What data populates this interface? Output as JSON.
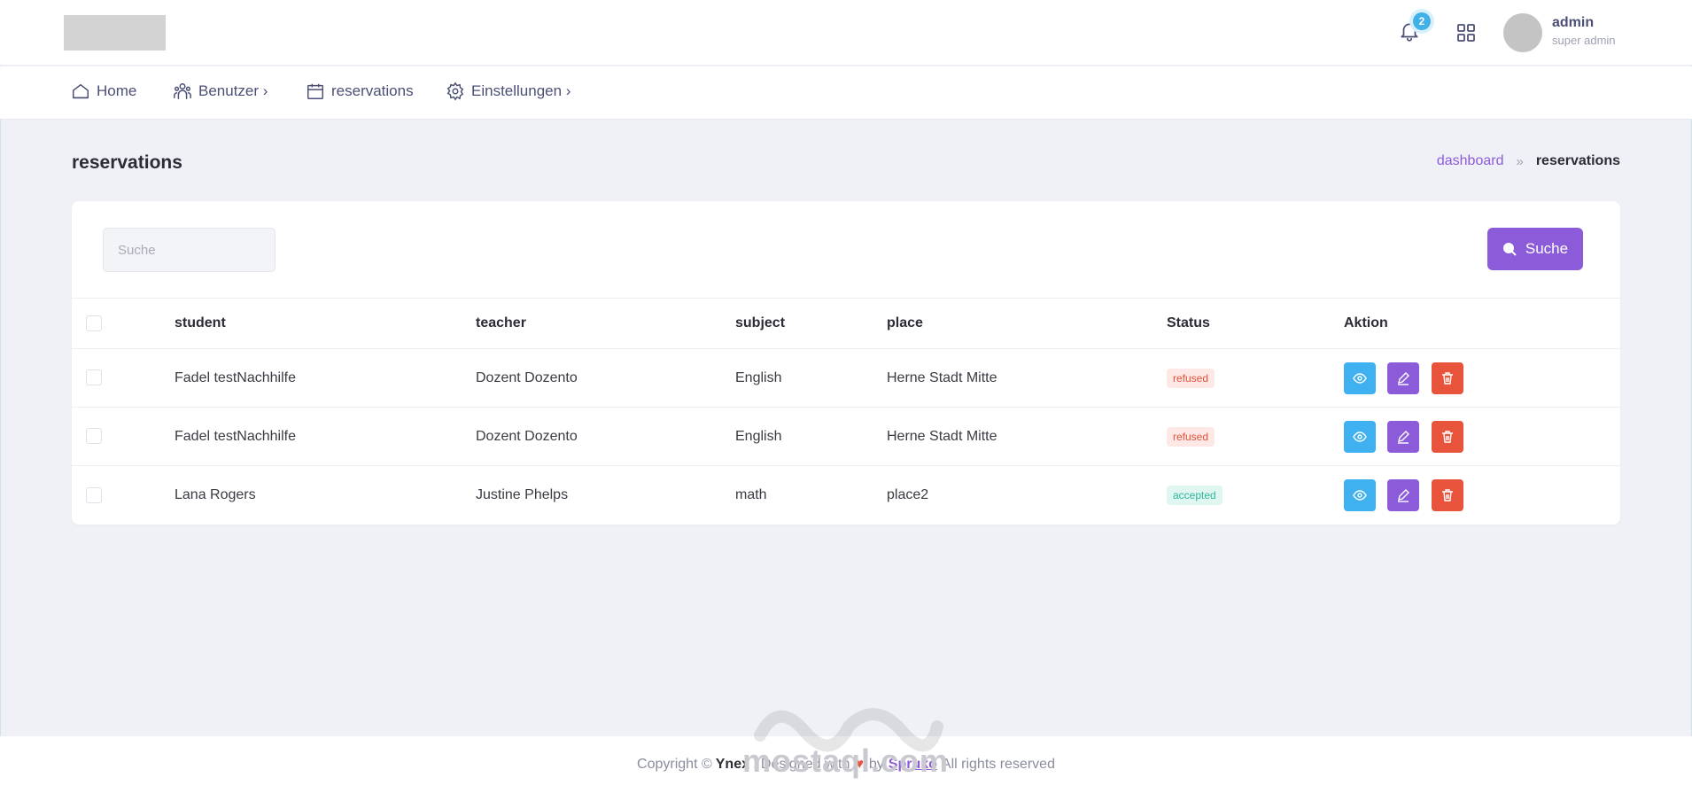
{
  "header": {
    "notification_count": "2",
    "user_name": "admin",
    "user_role": "super admin"
  },
  "nav": {
    "items": [
      {
        "label": "Home",
        "icon": "home-icon"
      },
      {
        "label": "Benutzer ›",
        "icon": "users-icon"
      },
      {
        "label": "reservations",
        "icon": "calendar-icon"
      },
      {
        "label": "Einstellungen ›",
        "icon": "settings-icon"
      }
    ]
  },
  "page": {
    "title": "reservations",
    "breadcrumb": {
      "link": "dashboard",
      "separator": "»",
      "current": "reservations"
    }
  },
  "search": {
    "placeholder": "Suche",
    "button_label": "Suche"
  },
  "table": {
    "columns": [
      "student",
      "teacher",
      "subject",
      "place",
      "Status",
      "Aktion"
    ],
    "rows": [
      {
        "student": "Fadel testNachhilfe",
        "teacher": "Dozent Dozento",
        "subject": "English",
        "place": "Herne Stadt Mitte",
        "status": "refused"
      },
      {
        "student": "Fadel testNachhilfe",
        "teacher": "Dozent Dozento",
        "subject": "English",
        "place": "Herne Stadt Mitte",
        "status": "refused"
      },
      {
        "student": "Lana Rogers",
        "teacher": "Justine Phelps",
        "subject": "math",
        "place": "place2",
        "status": "accepted"
      }
    ]
  },
  "footer": {
    "prefix": "Copyright ©",
    "brand": "Ynex",
    "designed": ". Designed with",
    "heart": "♥",
    "by": "by",
    "company": "Spruko",
    "suffix": "All rights reserved"
  },
  "watermark": {
    "text": "mostaql.com"
  },
  "colors": {
    "primary": "#8c5bd9",
    "info": "#3fb1f0",
    "danger": "#e8533b",
    "background": "#f0f1f7"
  }
}
